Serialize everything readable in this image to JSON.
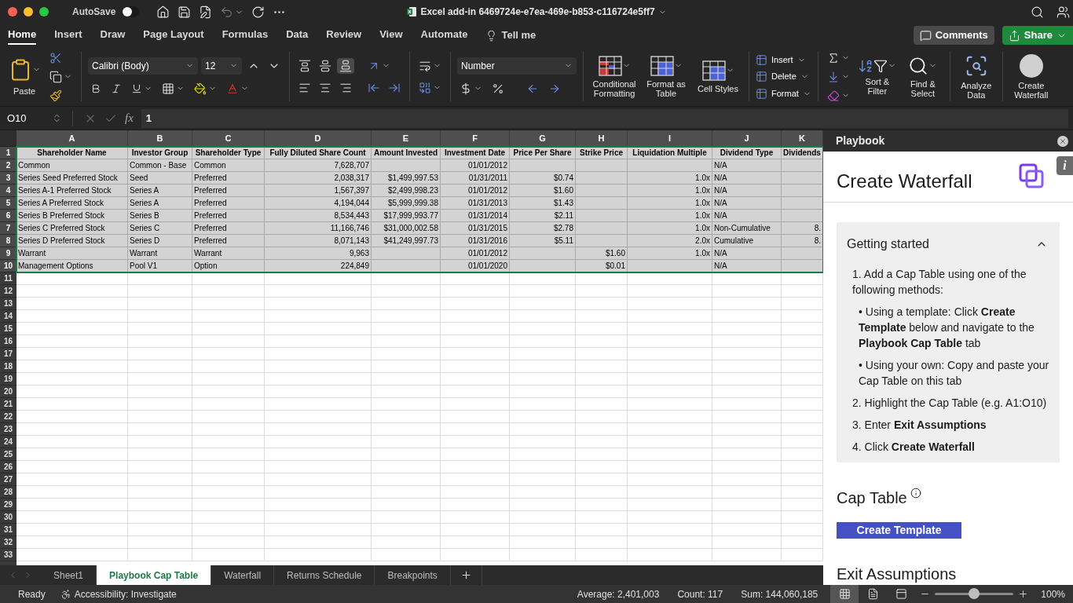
{
  "window": {
    "title": "Excel add-in 6469724e-e7ea-469e-b853-c116724e5ff7",
    "autosave": {
      "label": "AutoSave",
      "on": false
    }
  },
  "ribbon_tabs": [
    {
      "label": "Home",
      "selected": true
    },
    {
      "label": "Insert",
      "selected": false
    },
    {
      "label": "Draw",
      "selected": false
    },
    {
      "label": "Page Layout",
      "selected": false
    },
    {
      "label": "Formulas",
      "selected": false
    },
    {
      "label": "Data",
      "selected": false
    },
    {
      "label": "Review",
      "selected": false
    },
    {
      "label": "View",
      "selected": false
    },
    {
      "label": "Automate",
      "selected": false
    }
  ],
  "tell_me": "Tell me",
  "comments_button": "Comments",
  "share_button": "Share",
  "ribbon": {
    "paste": "Paste",
    "font": "Calibri (Body)",
    "font_size": "12",
    "number_format": "Number",
    "styles": [
      "Conditional Formatting",
      "Format as Table",
      "Cell Styles"
    ],
    "cells": [
      "Insert",
      "Delete",
      "Format"
    ],
    "sort": "Sort & Filter",
    "find": "Find & Select",
    "analyze": "Analyze Data",
    "waterfall": "Create Waterfall"
  },
  "formula_bar": {
    "cell": "O10",
    "function_label": "fx",
    "value": "1"
  },
  "sheet": {
    "columns": [
      {
        "letter": "A",
        "kind": "text"
      },
      {
        "letter": "B",
        "kind": "text"
      },
      {
        "letter": "C",
        "kind": "text"
      },
      {
        "letter": "D",
        "kind": "number"
      },
      {
        "letter": "E",
        "kind": "number"
      },
      {
        "letter": "F",
        "kind": "number"
      },
      {
        "letter": "G",
        "kind": "number"
      },
      {
        "letter": "H",
        "kind": "number"
      },
      {
        "letter": "I",
        "kind": "number"
      },
      {
        "letter": "J",
        "kind": "text"
      },
      {
        "letter": "K",
        "kind": "number"
      }
    ],
    "rows": [
      {
        "number": "1",
        "selected": true,
        "kind": "header",
        "cells": [
          "Shareholder Name",
          "Investor Group",
          "Shareholder Type",
          "Fully Diluted Share Count",
          "Amount Invested",
          "Investment Date",
          "Price Per Share",
          "Strike Price",
          "Liquidation Multiple",
          "Dividend Type",
          "Dividends"
        ]
      },
      {
        "number": "2",
        "selected": true,
        "kind": "data",
        "cells": [
          "Common",
          "Common - Base",
          "Common",
          "7,628,707",
          null,
          "01/01/2012",
          null,
          null,
          null,
          "N/A",
          null
        ]
      },
      {
        "number": "3",
        "selected": true,
        "kind": "data",
        "cells": [
          "Series Seed Preferred Stock",
          "Seed",
          "Preferred",
          "2,038,317",
          "$1,499,997.53",
          "01/31/2011",
          "$0.74",
          null,
          "1.0x",
          "N/A",
          null
        ]
      },
      {
        "number": "4",
        "selected": true,
        "kind": "data",
        "cells": [
          "Series A-1 Preferred Stock",
          "Series A",
          "Preferred",
          "1,567,397",
          "$2,499,998.23",
          "01/01/2012",
          "$1.60",
          null,
          "1.0x",
          "N/A",
          null
        ]
      },
      {
        "number": "5",
        "selected": true,
        "kind": "data",
        "cells": [
          "Series A Preferred Stock",
          "Series A",
          "Preferred",
          "4,194,044",
          "$5,999,999.38",
          "01/31/2013",
          "$1.43",
          null,
          "1.0x",
          "N/A",
          null
        ]
      },
      {
        "number": "6",
        "selected": true,
        "kind": "data",
        "cells": [
          "Series B Preferred Stock",
          "Series B",
          "Preferred",
          "8,534,443",
          "$17,999,993.77",
          "01/31/2014",
          "$2.11",
          null,
          "1.0x",
          "N/A",
          null
        ]
      },
      {
        "number": "7",
        "selected": true,
        "kind": "data",
        "cells": [
          "Series C Preferred Stock",
          "Series C",
          "Preferred",
          "11,166,746",
          "$31,000,002.58",
          "01/31/2015",
          "$2.78",
          null,
          "1.0x",
          "Non-Cumulative",
          "8."
        ]
      },
      {
        "number": "8",
        "selected": true,
        "kind": "data",
        "cells": [
          "Series D Preferred Stock",
          "Series D",
          "Preferred",
          "8,071,143",
          "$41,249,997.73",
          "01/31/2016",
          "$5.11",
          null,
          "2.0x",
          "Cumulative",
          "8."
        ]
      },
      {
        "number": "9",
        "selected": true,
        "kind": "data",
        "cells": [
          "Warrant",
          "Warrant",
          "Warrant",
          "9,963",
          null,
          "01/01/2012",
          null,
          "$1.60",
          "1.0x",
          "N/A",
          null
        ]
      },
      {
        "number": "10",
        "selected": true,
        "kind": "data",
        "cells": [
          "Management Options",
          "Pool V1",
          "Option",
          "224,849",
          null,
          "01/01/2020",
          null,
          "$0.01",
          null,
          "N/A",
          null
        ]
      },
      {
        "number": "11",
        "selected": false
      },
      {
        "number": "12",
        "selected": false
      },
      {
        "number": "13",
        "selected": false
      },
      {
        "number": "14",
        "selected": false
      },
      {
        "number": "15",
        "selected": false
      },
      {
        "number": "16",
        "selected": false
      },
      {
        "number": "17",
        "selected": false
      },
      {
        "number": "18",
        "selected": false
      },
      {
        "number": "19",
        "selected": false
      },
      {
        "number": "20",
        "selected": false
      },
      {
        "number": "21",
        "selected": false
      },
      {
        "number": "22",
        "selected": false
      },
      {
        "number": "23",
        "selected": false
      },
      {
        "number": "24",
        "selected": false
      },
      {
        "number": "25",
        "selected": false
      },
      {
        "number": "26",
        "selected": false
      },
      {
        "number": "27",
        "selected": false
      },
      {
        "number": "28",
        "selected": false
      },
      {
        "number": "29",
        "selected": false
      },
      {
        "number": "30",
        "selected": false
      },
      {
        "number": "31",
        "selected": false
      },
      {
        "number": "32",
        "selected": false
      },
      {
        "number": "33",
        "selected": false
      }
    ]
  },
  "panel": {
    "header": "Playbook",
    "title": "Create Waterfall",
    "info_tab": "i",
    "getting_started": {
      "label": "Getting started",
      "expanded": true,
      "steps": [
        {
          "text": "1. Add a Cap Table using one of the following methods:",
          "children": [
            {
              "text": "• Using a template: Click **Create Template** below and navigate to the **Playbook Cap Table** tab"
            },
            {
              "text": "• Using your own: Copy and paste your Cap Table on this tab"
            }
          ]
        },
        {
          "text": "2. Highlight the Cap Table (e.g. A1:O10)"
        },
        {
          "text": "3. Enter **Exit Assumptions**"
        },
        {
          "text": "4. Click **Create Waterfall**"
        }
      ]
    },
    "cap_table": {
      "heading": "Cap Table",
      "button": "Create Template"
    },
    "exit_heading": "Exit Assumptions"
  },
  "sheet_tabs": [
    {
      "label": "Sheet1",
      "selected": false
    },
    {
      "label": "Playbook Cap Table",
      "selected": true
    },
    {
      "label": "Waterfall",
      "selected": false
    },
    {
      "label": "Returns Schedule",
      "selected": false
    },
    {
      "label": "Breakpoints",
      "selected": false
    }
  ],
  "status_bar": {
    "status": "Ready",
    "accessibility": "Accessibility: Investigate",
    "stats": [
      "Average: 2,401,003",
      "Count: 117",
      "Sum: 144,060,185"
    ],
    "views": [
      {
        "kind": "normal",
        "selected": true
      },
      {
        "kind": "page_layout",
        "selected": false
      },
      {
        "kind": "page_break",
        "selected": false
      }
    ],
    "zoom": {
      "level": 0.5,
      "label": "100%"
    }
  }
}
